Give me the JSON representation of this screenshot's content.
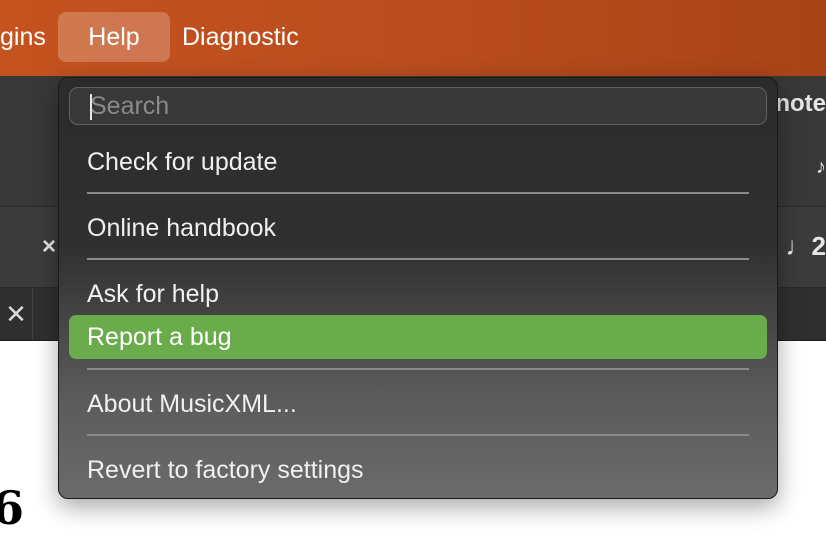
{
  "menubar": {
    "items": [
      {
        "label": "gins"
      },
      {
        "label": "Help"
      },
      {
        "label": "Diagnostic"
      }
    ]
  },
  "background": {
    "toolbar_text": "note",
    "toolbar2_left": "×",
    "toolbar2_right": "2",
    "canvas_text": "6"
  },
  "help_menu": {
    "search_placeholder": "Search",
    "items": [
      {
        "label": "Check for update"
      },
      {
        "label": "Online handbook"
      },
      {
        "label": "Ask for help"
      },
      {
        "label": "Report a bug"
      },
      {
        "label": "About MusicXML..."
      },
      {
        "label": "Revert to factory settings"
      }
    ],
    "highlight_color": "#6aac4c"
  },
  "colors": {
    "menubar": "#b94d1e",
    "menu_bg": "#2b2b2b"
  }
}
